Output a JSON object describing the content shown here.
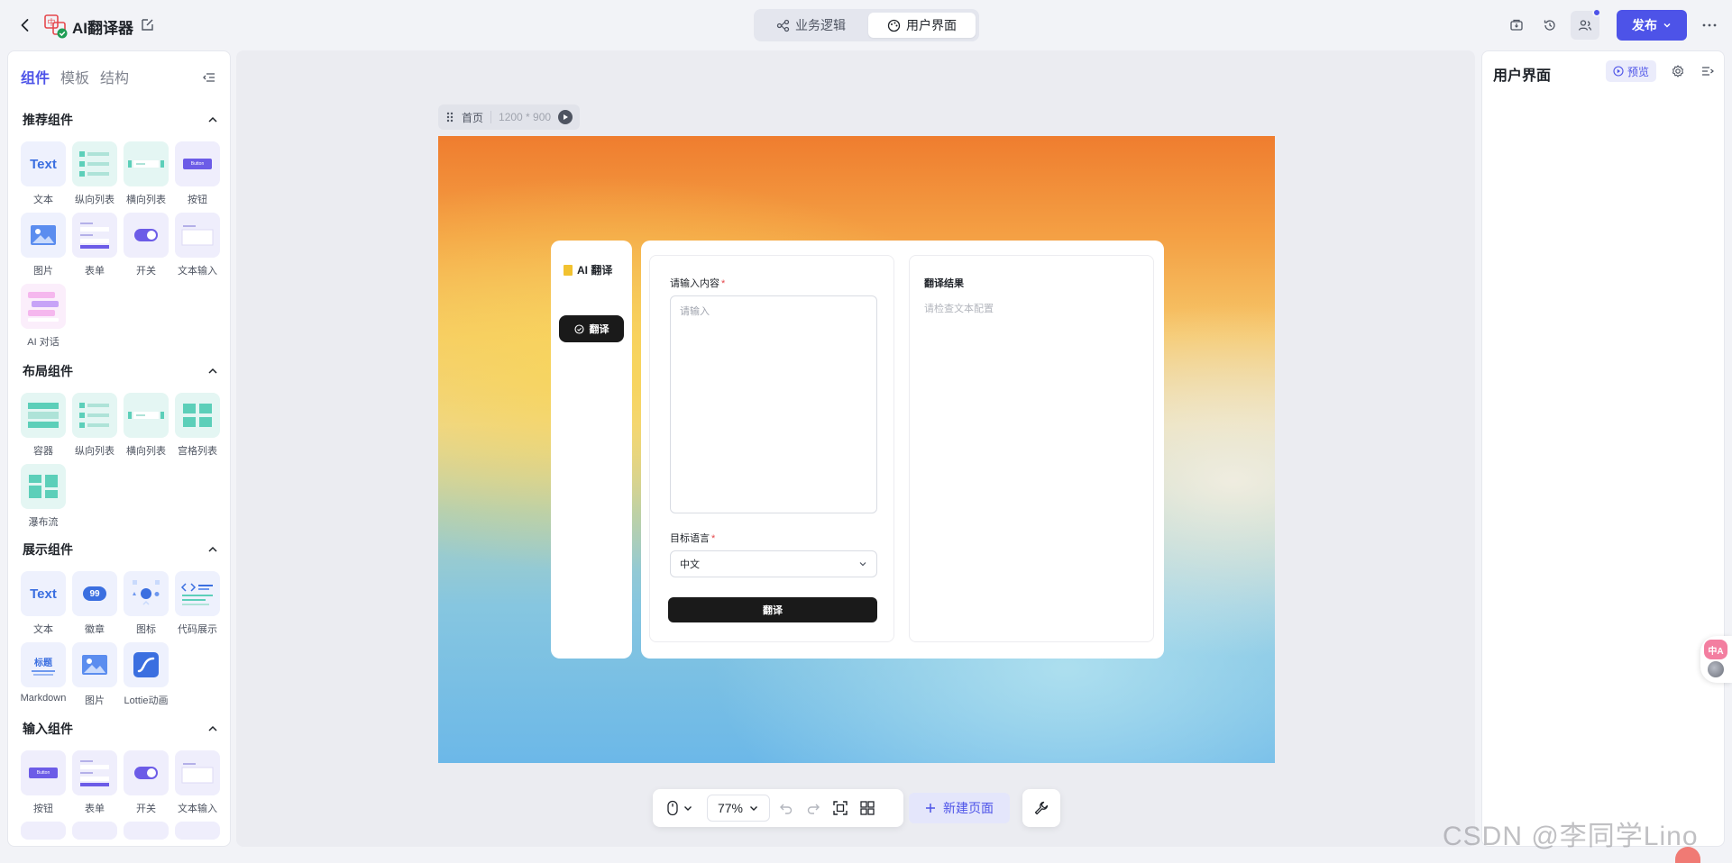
{
  "topbar": {
    "title": "AI翻译器",
    "modes": [
      {
        "label": "业务逻辑",
        "active": false
      },
      {
        "label": "用户界面",
        "active": true
      }
    ],
    "publish_label": "发布"
  },
  "left_panel": {
    "tabs": [
      {
        "label": "组件",
        "active": true
      },
      {
        "label": "模板",
        "active": false
      },
      {
        "label": "结构",
        "active": false
      }
    ],
    "sections": [
      {
        "title": "推荐组件",
        "items": [
          {
            "label": "文本",
            "icon": "text-icon",
            "tile_glyph": "Text"
          },
          {
            "label": "纵向列表",
            "icon": "vertical-list-icon"
          },
          {
            "label": "横向列表",
            "icon": "horizontal-list-icon"
          },
          {
            "label": "按钮",
            "icon": "button-icon",
            "tile_glyph": "Button"
          },
          {
            "label": "图片",
            "icon": "image-icon"
          },
          {
            "label": "表单",
            "icon": "form-icon"
          },
          {
            "label": "开关",
            "icon": "switch-icon"
          },
          {
            "label": "文本输入",
            "icon": "text-input-icon"
          },
          {
            "label": "AI 对话",
            "icon": "ai-chat-icon"
          }
        ]
      },
      {
        "title": "布局组件",
        "items": [
          {
            "label": "容器",
            "icon": "container-icon"
          },
          {
            "label": "纵向列表",
            "icon": "vertical-list-icon"
          },
          {
            "label": "横向列表",
            "icon": "horizontal-list-icon"
          },
          {
            "label": "宫格列表",
            "icon": "grid-list-icon"
          },
          {
            "label": "瀑布流",
            "icon": "waterfall-icon"
          }
        ]
      },
      {
        "title": "展示组件",
        "items": [
          {
            "label": "文本",
            "icon": "text-icon",
            "tile_glyph": "Text"
          },
          {
            "label": "徽章",
            "icon": "badge-icon",
            "tile_glyph": "99"
          },
          {
            "label": "图标",
            "icon": "icons-icon"
          },
          {
            "label": "代码展示",
            "icon": "code-icon"
          },
          {
            "label": "Markdown",
            "icon": "markdown-icon",
            "tile_glyph": "标题"
          },
          {
            "label": "图片",
            "icon": "image-icon"
          },
          {
            "label": "Lottie动画",
            "icon": "lottie-icon"
          }
        ]
      },
      {
        "title": "输入组件",
        "items": [
          {
            "label": "按钮",
            "icon": "button-icon",
            "tile_glyph": "Button"
          },
          {
            "label": "表单",
            "icon": "form-icon"
          },
          {
            "label": "开关",
            "icon": "switch-icon"
          },
          {
            "label": "文本输入",
            "icon": "text-input-icon"
          }
        ]
      }
    ]
  },
  "canvas": {
    "page_name": "首页",
    "page_size": "1200 * 900",
    "app": {
      "brand": "AI 翻译",
      "nav_label": "翻译",
      "input_label": "请输入内容",
      "input_placeholder": "请输入",
      "language_label": "目标语言",
      "language_value": "中文",
      "submit_label": "翻译",
      "result_title": "翻译结果",
      "result_placeholder": "请检查文本配置"
    }
  },
  "toolbar": {
    "zoom": "77%",
    "new_page_label": "新建页面"
  },
  "right_panel": {
    "title": "用户界面",
    "preview_label": "预览"
  },
  "float_widget_label": "中A",
  "watermark": "CSDN @李同学Lino",
  "colors": {
    "accent": "#4d53e8",
    "dark_button": "#1a1a1a",
    "required": "#e5484d"
  }
}
